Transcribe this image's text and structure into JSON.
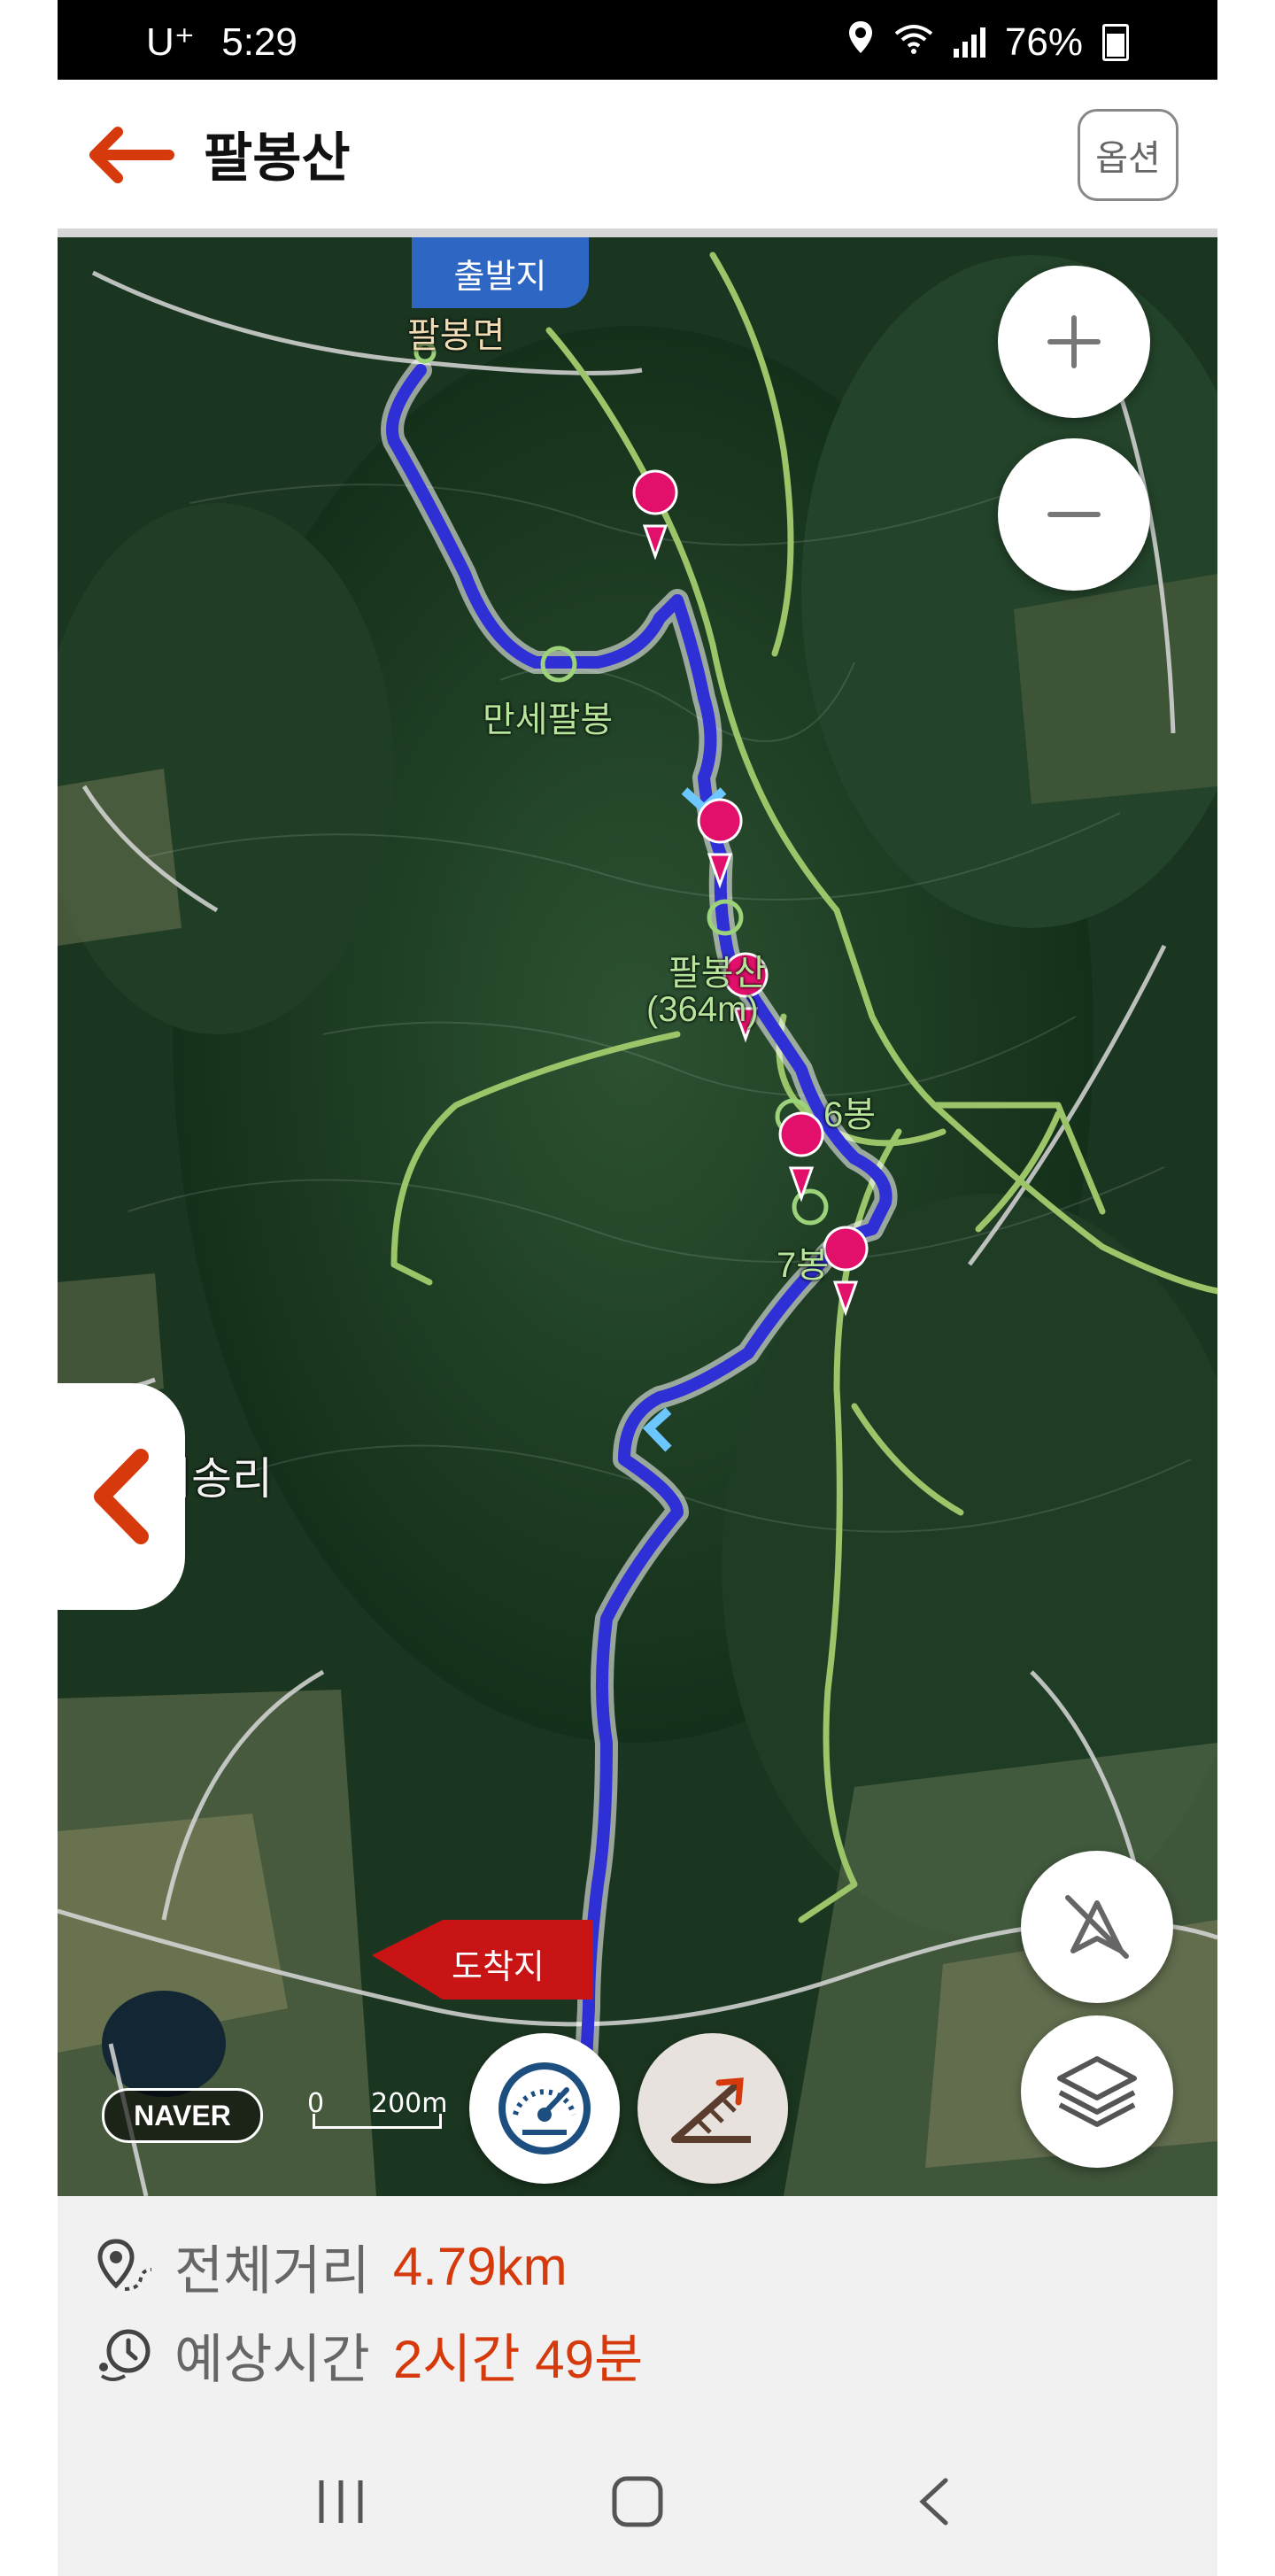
{
  "status_bar": {
    "carrier": "U⁺",
    "time": "5:29",
    "battery": "76%"
  },
  "header": {
    "title": "팔봉산",
    "option_label": "옵션"
  },
  "map": {
    "start_flag": "출발지",
    "end_flag": "도착지",
    "labels": {
      "town_start": "팔봉면",
      "peak_manse": "만세팔봉",
      "peak_main": "팔봉산",
      "peak_main_height": "(364m)",
      "peak_6": "6봉",
      "peak_7": "7봉",
      "village": "어송리"
    },
    "provider": "NAVER",
    "scale_zero": "0",
    "scale_distance": "200m",
    "colors": {
      "route": "#2f2fd6",
      "trail": "#9cc468",
      "marker": "#e2106b",
      "accent": "#d63a0c"
    }
  },
  "info": {
    "distance_label": "전체거리",
    "distance_value": "4.79km",
    "time_label": "예상시간",
    "time_value": "2시간 49분"
  }
}
